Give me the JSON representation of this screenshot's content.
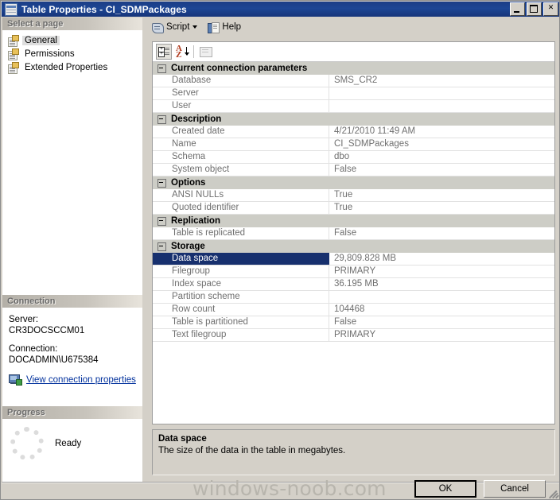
{
  "window": {
    "title": "Table Properties - CI_SDMPackages",
    "icon": "table-icon",
    "minimize_label": "",
    "maximize_label": "",
    "close_label": "✕"
  },
  "sidebar": {
    "header": "Select a page",
    "items": [
      {
        "label": "General",
        "selected": true
      },
      {
        "label": "Permissions",
        "selected": false
      },
      {
        "label": "Extended Properties",
        "selected": false
      }
    ]
  },
  "connection": {
    "header": "Connection",
    "server_label": "Server:",
    "server_value": "CR3DOCSCCM01",
    "connection_label": "Connection:",
    "connection_value": "DOCADMIN\\U675384",
    "link_label": "View connection properties",
    "link_icon": "network-computer-icon"
  },
  "progress": {
    "header": "Progress",
    "status": "Ready",
    "spinner_icon": "progress-spinner-icon"
  },
  "toolbar": {
    "script_label": "Script",
    "script_icon": "script-scroll-icon",
    "dropdown_icon": "chevron-down-icon",
    "help_label": "Help",
    "help_icon": "help-book-icon"
  },
  "grid_toolbar": {
    "categorized_icon": "categorized-view-icon",
    "alphabetical_icon": "alphabetical-sort-icon",
    "property_pages_icon": "property-pages-icon"
  },
  "grid": {
    "categories": [
      {
        "name": "Current connection parameters",
        "rows": [
          {
            "name": "Database",
            "value": "SMS_CR2",
            "selected": false
          },
          {
            "name": "Server",
            "value": "",
            "selected": false
          },
          {
            "name": "User",
            "value": "",
            "selected": false
          }
        ]
      },
      {
        "name": "Description",
        "rows": [
          {
            "name": "Created date",
            "value": "4/21/2010 11:49 AM",
            "selected": false
          },
          {
            "name": "Name",
            "value": "CI_SDMPackages",
            "selected": false
          },
          {
            "name": "Schema",
            "value": "dbo",
            "selected": false
          },
          {
            "name": "System object",
            "value": "False",
            "selected": false
          }
        ]
      },
      {
        "name": "Options",
        "rows": [
          {
            "name": "ANSI NULLs",
            "value": "True",
            "selected": false
          },
          {
            "name": "Quoted identifier",
            "value": "True",
            "selected": false
          }
        ]
      },
      {
        "name": "Replication",
        "rows": [
          {
            "name": "Table is replicated",
            "value": "False",
            "selected": false
          }
        ]
      },
      {
        "name": "Storage",
        "rows": [
          {
            "name": "Data space",
            "value": "29,809.828 MB",
            "selected": true
          },
          {
            "name": "Filegroup",
            "value": "PRIMARY",
            "selected": false
          },
          {
            "name": "Index space",
            "value": "36.195 MB",
            "selected": false
          },
          {
            "name": "Partition scheme",
            "value": "",
            "selected": false
          },
          {
            "name": "Row count",
            "value": "104468",
            "selected": false
          },
          {
            "name": "Table is partitioned",
            "value": "False",
            "selected": false
          },
          {
            "name": "Text filegroup",
            "value": "PRIMARY",
            "selected": false
          }
        ]
      }
    ]
  },
  "description_pane": {
    "title": "Data space",
    "text": "The size of the data in the table in megabytes."
  },
  "footer": {
    "ok_label": "OK",
    "cancel_label": "Cancel",
    "watermark": "windows-noob.com"
  },
  "colors": {
    "titlebar": "#1d4694",
    "selection": "#17306e",
    "dialog_face": "#d4d0c8",
    "link": "#00309c",
    "category_row": "#cdcdc6"
  }
}
